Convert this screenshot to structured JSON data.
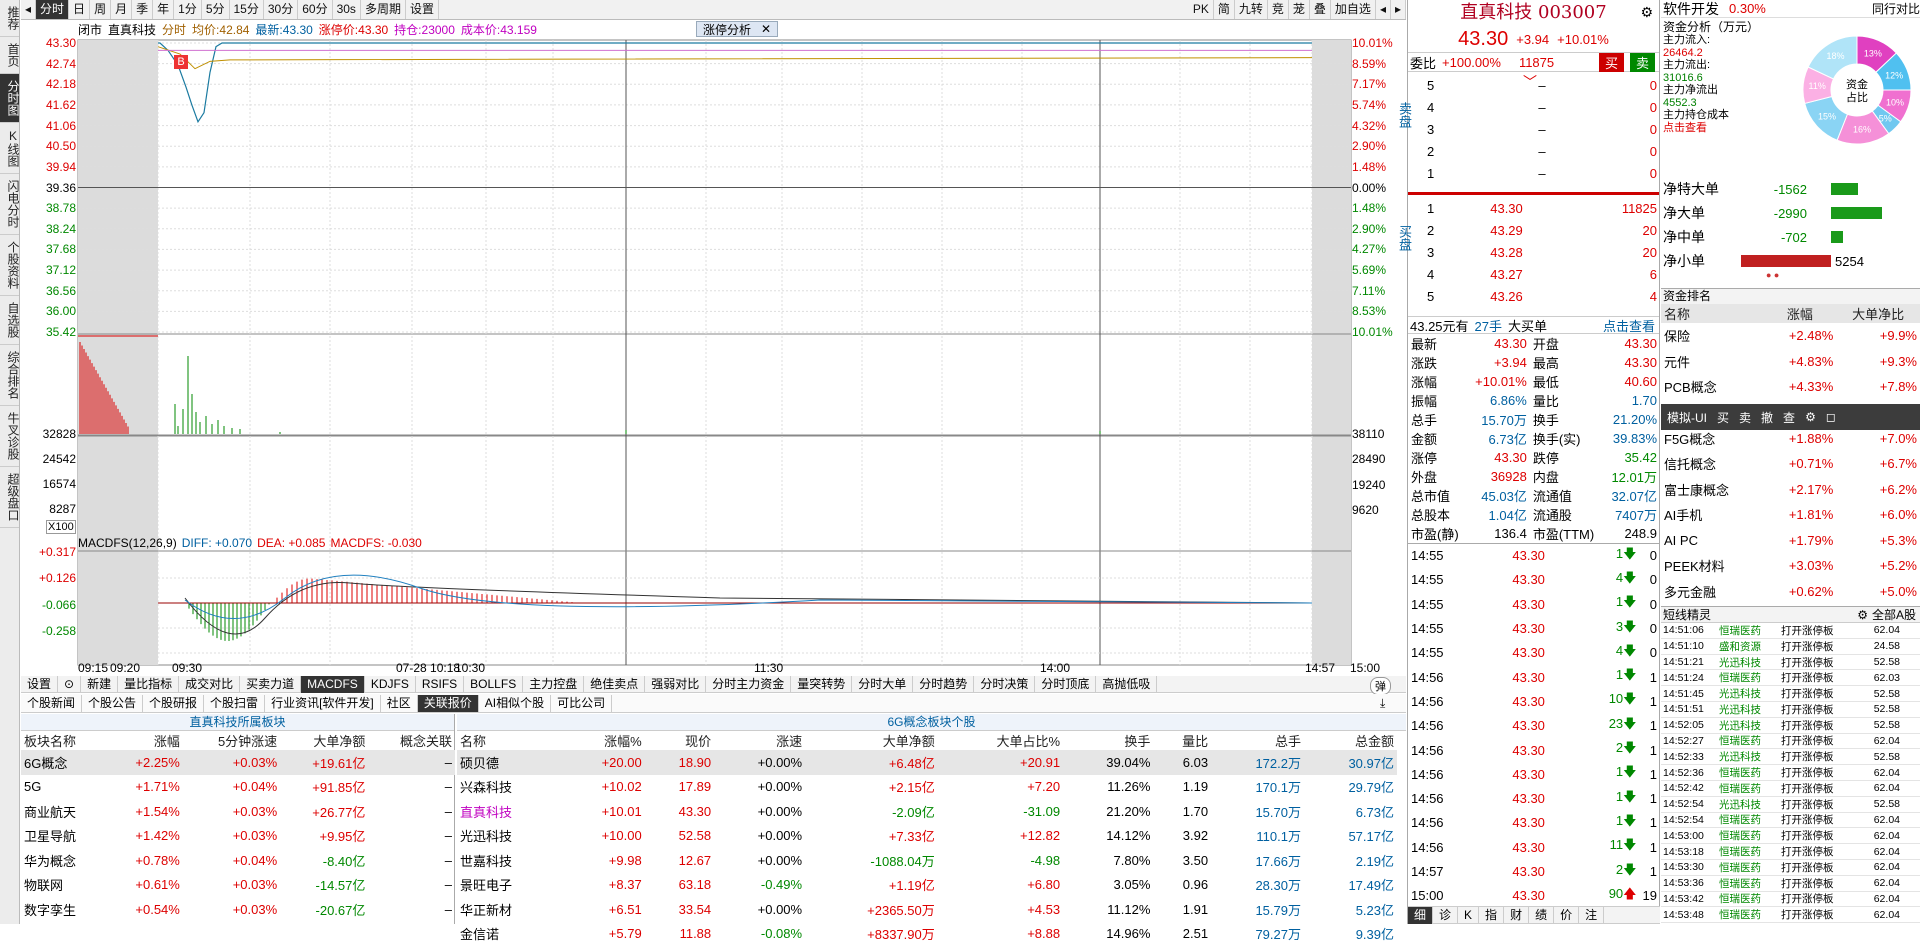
{
  "sidebar": [
    "推荐",
    "首页",
    "分时图",
    "K线图",
    "闪电分时",
    "个股资料",
    "自选股",
    "综合排名",
    "牛叉诊股",
    "超级盘口"
  ],
  "toolbar": {
    "items": [
      "◂",
      "分时",
      "日",
      "周",
      "月",
      "季",
      "年",
      "1分",
      "5分",
      "15分",
      "30分",
      "60分",
      "30s",
      "多周期",
      "设置"
    ],
    "right": [
      "PK",
      "简",
      "九转",
      "竞",
      "茏",
      "叠",
      "加自选",
      "◂",
      "▸"
    ]
  },
  "chart_header": {
    "mode": "闭市",
    "name": "直真科技",
    "fenshi": "分时",
    "avg_label": "均价:",
    "avg": "42.84",
    "latest_label": "最新:",
    "latest": "43.30",
    "limit_label": "涨停价:",
    "limit": "43.30",
    "pos_label": "持仓:",
    "pos": "23000",
    "cost_label": "成本价:",
    "cost": "43.159",
    "tag": "涨停分析",
    "marker": "B"
  },
  "price_axis": {
    "left": [
      "43.30",
      "42.74",
      "42.18",
      "41.62",
      "41.06",
      "40.50",
      "39.94",
      "39.36",
      "38.78",
      "38.24",
      "37.68",
      "37.12",
      "36.56",
      "36.00",
      "35.42"
    ],
    "right": [
      "10.01%",
      "8.59%",
      "7.17%",
      "5.74%",
      "4.32%",
      "2.90%",
      "1.48%",
      "0.00%",
      "1.48%",
      "2.90%",
      "4.27%",
      "5.69%",
      "7.11%",
      "8.53%",
      "10.01%"
    ]
  },
  "vol_axis": {
    "left": [
      "32828",
      "24542",
      "16574",
      "8287",
      "X100"
    ],
    "right": [
      "38110",
      "28490",
      "19240",
      "9620"
    ]
  },
  "macd": {
    "title": "MACDFS(12,26,9)",
    "diff": "DIFF: +0.070",
    "dea": "DEA: +0.085",
    "macdfs": "MACDFS: -0.030",
    "axis": [
      "+0.317",
      "+0.126",
      "-0.066",
      "-0.258"
    ]
  },
  "time_axis": [
    "09:15",
    "09:20",
    "09:30",
    "07-28 10:18",
    "10:30",
    "11:30",
    "14:00",
    "14:57",
    "15:00"
  ],
  "indicator_tabs": [
    "设置",
    "⊙",
    "新建",
    "量比指标",
    "成交对比",
    "买卖力道",
    "MACDFS",
    "KDJFS",
    "RSIFS",
    "BOLLFS",
    "主力控盘",
    "绝佳卖点",
    "强弱对比",
    "分时主力资金",
    "量突转势",
    "分时大单",
    "分时趋势",
    "分时决策",
    "分时顶底",
    "高抛低吸"
  ],
  "indicator_right": "弹",
  "news_tabs": [
    "个股新闻",
    "个股公告",
    "个股研报",
    "个股扫雷",
    "行业资讯[软件开发]",
    "社区",
    "关联报价",
    "AI相似个股",
    "可比公司"
  ],
  "sector_panel": {
    "title": "直真科技所属板块",
    "headers": [
      "板块名称",
      "涨幅",
      "5分钟涨速",
      "大单净额",
      "概念关联"
    ],
    "rows": [
      [
        "6G概念",
        "+2.25%",
        "+0.03%",
        "+19.61亿",
        "–"
      ],
      [
        "5G",
        "+1.71%",
        "+0.04%",
        "+91.85亿",
        "–"
      ],
      [
        "商业航天",
        "+1.54%",
        "+0.03%",
        "+26.77亿",
        "–"
      ],
      [
        "卫星导航",
        "+1.42%",
        "+0.03%",
        "+9.95亿",
        "–"
      ],
      [
        "华为概念",
        "+0.78%",
        "+0.04%",
        "-8.40亿",
        "–"
      ],
      [
        "物联网",
        "+0.61%",
        "+0.03%",
        "-14.57亿",
        "–"
      ],
      [
        "数字孪生",
        "+0.54%",
        "+0.03%",
        "-20.67亿",
        "–"
      ]
    ]
  },
  "stock_panel": {
    "title": "6G概念板块个股",
    "headers": [
      "名称",
      "涨幅%",
      "现价",
      "涨速",
      "大单净额",
      "大单占比%",
      "换手",
      "量比",
      "总手",
      "总金额"
    ],
    "rows": [
      [
        "硕贝德",
        "+20.00",
        "18.90",
        "+0.00%",
        "+6.48亿",
        "+20.91",
        "39.04%",
        "6.03",
        "172.2万",
        "30.97亿"
      ],
      [
        "兴森科技",
        "+10.02",
        "17.89",
        "+0.00%",
        "+2.15亿",
        "+7.20",
        "11.26%",
        "1.19",
        "170.1万",
        "29.79亿"
      ],
      [
        "直真科技",
        "+10.01",
        "43.30",
        "+0.00%",
        "-2.09亿",
        "-31.09",
        "21.20%",
        "1.70",
        "15.70万",
        "6.73亿"
      ],
      [
        "光迅科技",
        "+10.00",
        "52.58",
        "+0.00%",
        "+7.33亿",
        "+12.82",
        "14.12%",
        "3.92",
        "110.1万",
        "57.17亿"
      ],
      [
        "世嘉科技",
        "+9.98",
        "12.67",
        "+0.00%",
        "-1088.04万",
        "-4.98",
        "7.80%",
        "3.50",
        "17.66万",
        "2.19亿"
      ],
      [
        "景旺电子",
        "+8.37",
        "63.18",
        "-0.49%",
        "+1.19亿",
        "+6.80",
        "3.05%",
        "0.96",
        "28.30万",
        "17.49亿"
      ],
      [
        "华正新材",
        "+6.51",
        "33.54",
        "+0.00%",
        "+2365.50万",
        "+4.53",
        "11.12%",
        "1.91",
        "15.79万",
        "5.23亿"
      ],
      [
        "金信诺",
        "+5.79",
        "11.88",
        "-0.08%",
        "+8337.90万",
        "+8.88",
        "14.96%",
        "2.51",
        "79.27万",
        "9.39亿"
      ]
    ]
  },
  "quote": {
    "name": "直真科技",
    "code": "003007",
    "price": "43.30",
    "change": "+3.94",
    "pct": "+10.01%",
    "weibi_label": "委比",
    "weibi": "+100.00%",
    "weicha": "11875",
    "buy_btn": "买",
    "sell_btn": "卖",
    "sell_label": "卖盘",
    "buy_label": "买盘",
    "sells": [
      [
        "5",
        "–",
        "0"
      ],
      [
        "4",
        "–",
        "0"
      ],
      [
        "3",
        "–",
        "0"
      ],
      [
        "2",
        "–",
        "0"
      ],
      [
        "1",
        "–",
        "0"
      ]
    ],
    "buys": [
      [
        "1",
        "43.30",
        "11825"
      ],
      [
        "2",
        "43.29",
        "20"
      ],
      [
        "3",
        "43.28",
        "20"
      ],
      [
        "4",
        "43.27",
        "6"
      ],
      [
        "5",
        "43.26",
        "4"
      ]
    ],
    "bigorder": "43.25元有",
    "bigorder_hand": "27手",
    "bigorder_type": "大买单",
    "bigorder_link": "点击查看",
    "stats": [
      [
        "最新",
        "43.30",
        "开盘",
        "43.30"
      ],
      [
        "涨跌",
        "+3.94",
        "最高",
        "43.30"
      ],
      [
        "涨幅",
        "+10.01%",
        "最低",
        "40.60"
      ],
      [
        "振幅",
        "6.86%",
        "量比",
        "1.70"
      ],
      [
        "总手",
        "15.70万",
        "换手",
        "21.20%"
      ],
      [
        "金额",
        "6.73亿",
        "换手(实)",
        "39.83%"
      ],
      [
        "涨停",
        "43.30",
        "跌停",
        "35.42"
      ],
      [
        "外盘",
        "36928",
        "内盘",
        "12.01万"
      ],
      [
        "总市值",
        "45.03亿",
        "流通值",
        "32.07亿"
      ],
      [
        "总股本",
        "1.04亿",
        "流通股",
        "7407万"
      ],
      [
        "市盈(静)",
        "136.4",
        "市盈(TTM)",
        "248.9"
      ]
    ],
    "ticks": [
      [
        "14:55",
        "43.30",
        "1",
        "down"
      ],
      [
        "14:55",
        "43.30",
        "4",
        "down"
      ],
      [
        "14:55",
        "43.30",
        "1",
        "down"
      ],
      [
        "14:55",
        "43.30",
        "3",
        "down"
      ],
      [
        "14:55",
        "43.30",
        "4",
        "down"
      ],
      [
        "14:56",
        "43.30",
        "1",
        "down"
      ],
      [
        "14:56",
        "43.30",
        "10",
        "down"
      ],
      [
        "14:56",
        "43.30",
        "23",
        "down"
      ],
      [
        "14:56",
        "43.30",
        "2",
        "down"
      ],
      [
        "14:56",
        "43.30",
        "1",
        "down"
      ],
      [
        "14:56",
        "43.30",
        "1",
        "down"
      ],
      [
        "14:56",
        "43.30",
        "1",
        "down"
      ],
      [
        "14:56",
        "43.30",
        "11",
        "down"
      ],
      [
        "14:57",
        "43.30",
        "2",
        "down"
      ],
      [
        "15:00",
        "43.30",
        "90",
        "up"
      ]
    ],
    "tick_extra": [
      "0",
      "0",
      "0",
      "0",
      "0",
      "1",
      "1",
      "1",
      "1",
      "1",
      "1",
      "1",
      "1",
      "1",
      "19"
    ],
    "bottom_tabs": [
      "细",
      "诊",
      "K",
      "指",
      "财",
      "绩",
      "价",
      "注"
    ]
  },
  "funds": {
    "sector": "软件开发",
    "sector_pct": "0.30%",
    "sector_right": "同行对比",
    "title": "资金分析（万元）",
    "in_label": "主力流入:",
    "in": "26464.2",
    "out_label": "主力流出:",
    "out": "31016.6",
    "net_label": "主力净流出",
    "net": "4552.3",
    "cost_label": "主力持仓成本",
    "cost_link": "点击查看",
    "donut_center": "资金占比",
    "donut_pcts": [
      "13%",
      "12%",
      "10%",
      "5%",
      "16%",
      "15%",
      "11%",
      "18%"
    ],
    "bars": [
      [
        "净特大单",
        "-1562"
      ],
      [
        "净大单",
        "-2990"
      ],
      [
        "净中单",
        "-702"
      ],
      [
        "净小单",
        "5254"
      ]
    ]
  },
  "rank": {
    "title": "资金排名",
    "headers": [
      "名称",
      "涨幅",
      "大单净比"
    ],
    "rows": [
      [
        "保险",
        "+2.48%",
        "+9.9%"
      ],
      [
        "元件",
        "+4.83%",
        "+9.3%"
      ],
      [
        "PCB概念",
        "+4.33%",
        "+7.8%"
      ],
      [
        "F5G概念",
        "+1.88%",
        "+7.0%"
      ],
      [
        "信托概念",
        "+0.71%",
        "+6.7%"
      ],
      [
        "富士康概念",
        "+2.17%",
        "+6.2%"
      ],
      [
        "AI手机",
        "+1.81%",
        "+6.0%"
      ],
      [
        "AI PC",
        "+1.79%",
        "+5.3%"
      ],
      [
        "PEEK材料",
        "+3.03%",
        "+5.2%"
      ],
      [
        "多元金融",
        "+0.62%",
        "+5.0%"
      ]
    ],
    "popup": [
      "模拟-UI",
      "买",
      "卖",
      "撤",
      "查",
      "⚙",
      "◻"
    ]
  },
  "short": {
    "title": "短线精灵",
    "filter": "全部A股",
    "rows": [
      [
        "14:51:06",
        "恒瑞医药",
        "打开涨停板",
        "62.04"
      ],
      [
        "14:51:10",
        "盛和资源",
        "打开涨停板",
        "24.58"
      ],
      [
        "14:51:21",
        "光迅科技",
        "打开涨停板",
        "52.58"
      ],
      [
        "14:51:24",
        "恒瑞医药",
        "打开涨停板",
        "62.03"
      ],
      [
        "14:51:45",
        "光迅科技",
        "打开涨停板",
        "52.58"
      ],
      [
        "14:51:51",
        "光迅科技",
        "打开涨停板",
        "52.58"
      ],
      [
        "14:52:05",
        "光迅科技",
        "打开涨停板",
        "52.58"
      ],
      [
        "14:52:27",
        "恒瑞医药",
        "打开涨停板",
        "62.04"
      ],
      [
        "14:52:33",
        "光迅科技",
        "打开涨停板",
        "52.58"
      ],
      [
        "14:52:36",
        "恒瑞医药",
        "打开涨停板",
        "62.04"
      ],
      [
        "14:52:42",
        "恒瑞医药",
        "打开涨停板",
        "62.04"
      ],
      [
        "14:52:54",
        "光迅科技",
        "打开涨停板",
        "52.58"
      ],
      [
        "14:52:54",
        "恒瑞医药",
        "打开涨停板",
        "62.04"
      ],
      [
        "14:53:00",
        "恒瑞医药",
        "打开涨停板",
        "62.04"
      ],
      [
        "14:53:18",
        "恒瑞医药",
        "打开涨停板",
        "62.04"
      ],
      [
        "14:53:30",
        "恒瑞医药",
        "打开涨停板",
        "62.04"
      ],
      [
        "14:53:36",
        "恒瑞医药",
        "打开涨停板",
        "62.04"
      ],
      [
        "14:53:42",
        "恒瑞医药",
        "打开涨停板",
        "62.04"
      ],
      [
        "14:53:48",
        "恒瑞医药",
        "打开涨停板",
        "62.04"
      ]
    ]
  }
}
